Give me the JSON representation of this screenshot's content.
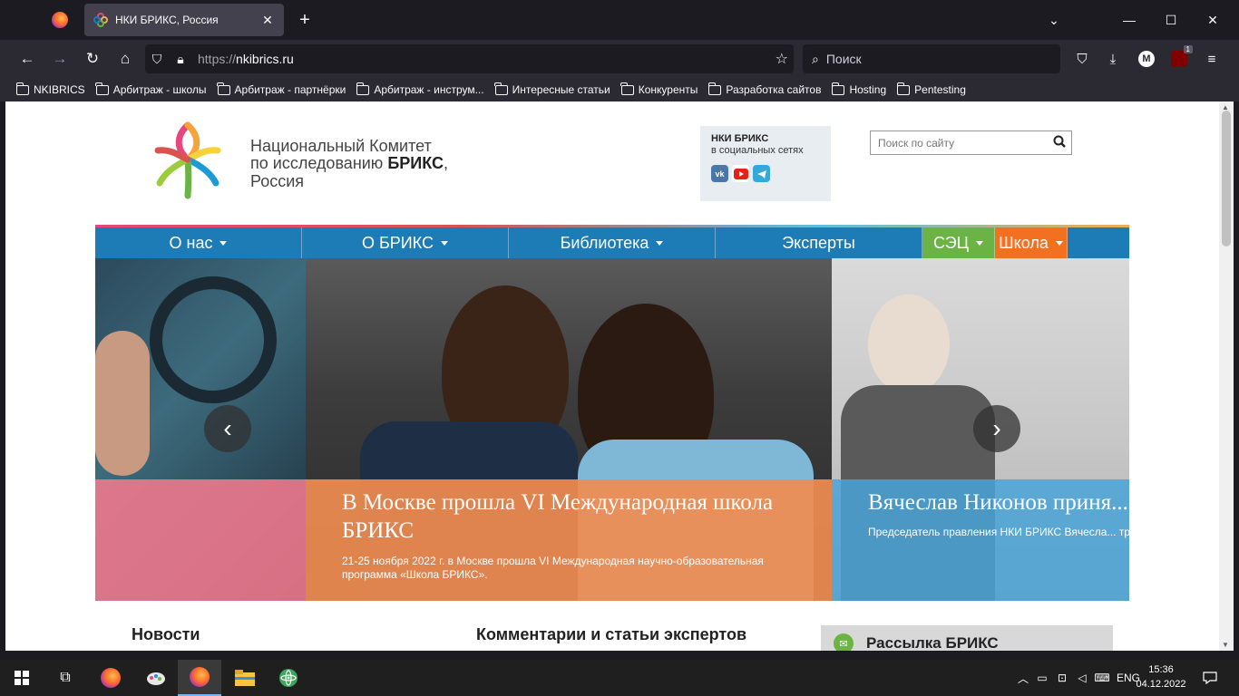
{
  "browser": {
    "tab_title": "НКИ БРИКС, Россия",
    "url_protocol": "https://",
    "url_domain": "nkibrics.ru",
    "search_placeholder": "Поиск",
    "account_initial": "M",
    "extension_badge": "1"
  },
  "bookmarks": [
    "NKIBRICS",
    "Арбитраж - школы",
    "Арбитраж - партнёрки",
    "Арбитраж - инструм...",
    "Интересные статьи",
    "Конкуренты",
    "Разработка сайтов",
    "Hosting",
    "Pentesting"
  ],
  "site": {
    "org_line1": "Национальный Комитет",
    "org_line2_prefix": "по исследованию ",
    "org_line2_bold": "БРИКС",
    "org_line2_suffix": ",",
    "org_line3": "Россия",
    "social_title": "НКИ БРИКС",
    "social_subtitle": "в социальных сетях",
    "search_placeholder": "Поиск по сайту",
    "menu": [
      {
        "label": "О нас",
        "dropdown": true
      },
      {
        "label": "О БРИКС",
        "dropdown": true
      },
      {
        "label": "Библиотека",
        "dropdown": true
      },
      {
        "label": "Эксперты",
        "dropdown": false
      },
      {
        "label": "СЭЦ",
        "dropdown": true
      },
      {
        "label": "Школа",
        "dropdown": true
      }
    ],
    "slides": {
      "main": {
        "title": "В Москве прошла VI Международная школа БРИКС",
        "text": "21-25 ноября 2022 г. в Москве прошла VI Международная научно-образовательная программа «Школа БРИКС»."
      },
      "next": {
        "title": "Вячеслав Никонов приня... VI Международной школ...",
        "text": "Председатель правления НКИ БРИКС Вячесла... традиционной лекцией на открытии Международ..."
      }
    },
    "sections": {
      "news": "Новости",
      "comments": "Комментарии и статьи экспертов",
      "newsletter": "Рассылка БРИКС"
    }
  },
  "taskbar": {
    "language": "ENG",
    "time": "15:36",
    "date": "04.12.2022"
  },
  "colors": {
    "menu_blue": "#1d7cb5",
    "sec_green": "#6ab344",
    "school_orange": "#f37021",
    "caption_orange": "#f08c50",
    "caption_pink": "#f27a8e",
    "caption_blue": "#4aa3d8"
  }
}
